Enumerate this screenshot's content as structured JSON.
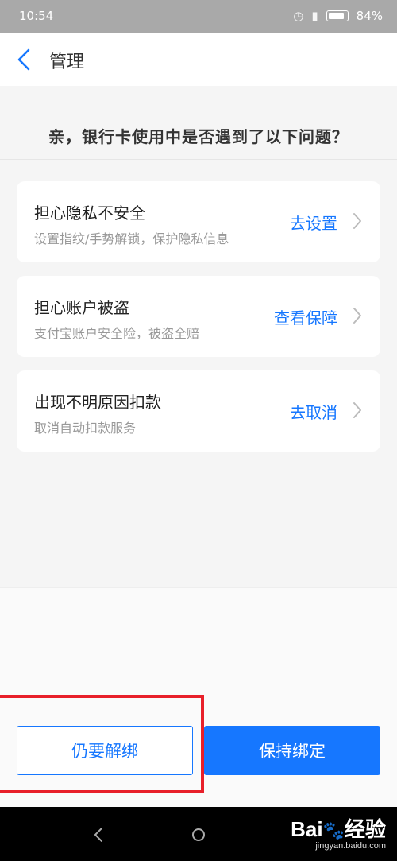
{
  "status_bar": {
    "time": "10:54",
    "battery": "84%"
  },
  "nav": {
    "title": "管理"
  },
  "question": "亲，银行卡使用中是否遇到了以下问题？",
  "cards": [
    {
      "title": "担心隐私不安全",
      "subtitle": "设置指纹/手势解锁，保护隐私信息",
      "action": "去设置"
    },
    {
      "title": "担心账户被盗",
      "subtitle": "支付宝账户安全险，被盗全赔",
      "action": "查看保障"
    },
    {
      "title": "出现不明原因扣款",
      "subtitle": "取消自动扣款服务",
      "action": "去取消"
    }
  ],
  "buttons": {
    "unbind": "仍要解绑",
    "keep": "保持绑定"
  },
  "watermark": {
    "logo": "Bai",
    "logo_suffix": "经验",
    "site": "jingyan.baidu.com"
  },
  "colors": {
    "accent": "#1677ff",
    "highlight": "#e8202a"
  }
}
